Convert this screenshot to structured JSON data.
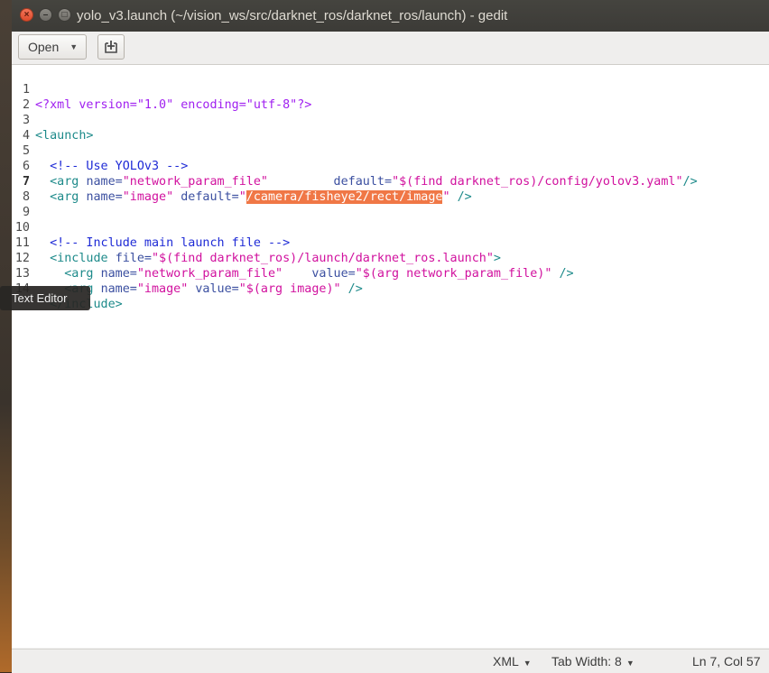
{
  "window": {
    "title": "yolo_v3.launch (~/vision_ws/src/darknet_ros/darknet_ros/launch) - gedit",
    "close_glyph": "×",
    "minimize_glyph": "–",
    "maximize_glyph": "□"
  },
  "toolbar": {
    "open_label": "Open",
    "new_tab_icon": "new-document-plus-icon"
  },
  "editor": {
    "current_line": 7,
    "selection": "/camera/fisheye2/rect/image",
    "lines": [
      {
        "n": "1"
      },
      {
        "n": "2"
      },
      {
        "n": "3"
      },
      {
        "n": "4"
      },
      {
        "n": "5"
      },
      {
        "n": "6"
      },
      {
        "n": "7"
      },
      {
        "n": "8"
      },
      {
        "n": "9"
      },
      {
        "n": "10"
      },
      {
        "n": "11"
      },
      {
        "n": "12"
      },
      {
        "n": "13"
      },
      {
        "n": "14"
      }
    ],
    "tokens": {
      "l1_pi": "<?xml version=\"1.0\" encoding=\"utf-8\"?>",
      "l3_tag": "<launch>",
      "l5_cmt": "  <!-- Use YOLOv3 -->",
      "l6_tag_open": "  <arg ",
      "l6_attr1": "name=",
      "l6_str1": "\"network_param_file\"",
      "l6_attr2": "         default=",
      "l6_str2": "\"$(find darknet_ros)/config/yolov3.yaml\"",
      "l6_tag_close": "/>",
      "l7_tag_open": "  <arg ",
      "l7_attr1": "name=",
      "l7_str1": "\"image\"",
      "l7_attr2": " default=",
      "l7_str2_open": "\"",
      "l7_str2_close": "\"",
      "l7_tag_close": " />",
      "l10_cmt": "  <!-- Include main launch file -->",
      "l11_tag_open": "  <include ",
      "l11_attr1": "file=",
      "l11_str1": "\"$(find darknet_ros)/launch/darknet_ros.launch\"",
      "l11_tag_close": ">",
      "l12_tag_open": "    <arg ",
      "l12_attr1": "name=",
      "l12_str1": "\"network_param_file\"",
      "l12_attr2": "    value=",
      "l12_str2": "\"$(arg network_param_file)\"",
      "l12_tag_close": " />",
      "l13_tag_open": "    <arg ",
      "l13_attr1": "name=",
      "l13_str1": "\"image\"",
      "l13_attr2": " value=",
      "l13_str2": "\"$(arg image)\"",
      "l13_tag_close": " />",
      "l14_tag": "  </include>"
    }
  },
  "tooltip": {
    "text": "Text Editor"
  },
  "statusbar": {
    "language": "XML",
    "tab_width": "Tab Width: 8",
    "position": "Ln 7, Col 57"
  }
}
